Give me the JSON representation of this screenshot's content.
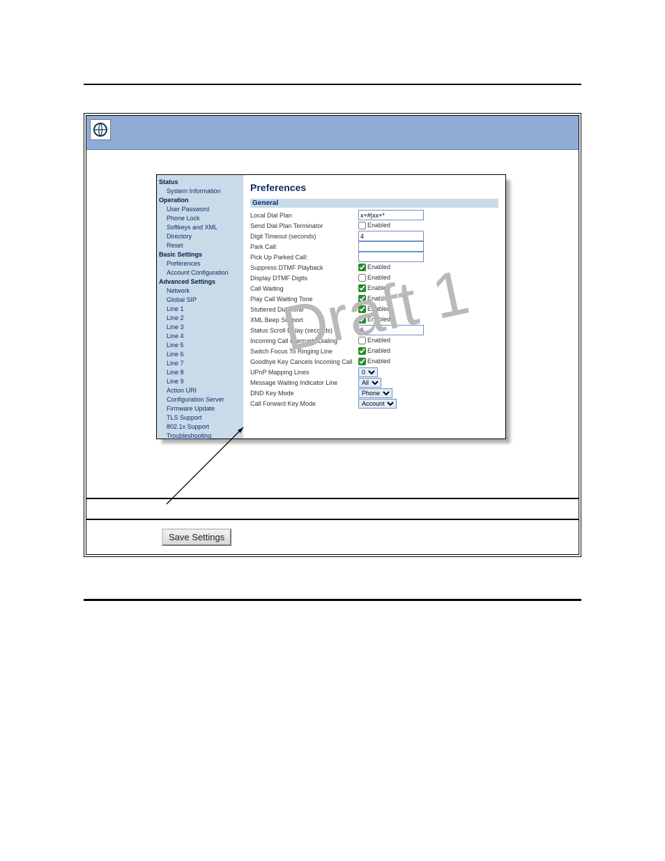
{
  "section_header": {
    "general": "General"
  },
  "title": "Preferences",
  "nav": {
    "status": "Status",
    "sysinfo": "System Information",
    "operation": "Operation",
    "userpw": "User Password",
    "phonelock": "Phone Lock",
    "softkeys": "Softkeys and XML",
    "directory": "Directory",
    "reset": "Reset",
    "basic": "Basic Settings",
    "prefs": "Preferences",
    "acct": "Account Configuration",
    "adv": "Advanced Settings",
    "network": "Network",
    "gsip": "Global SIP",
    "l1": "Line 1",
    "l2": "Line 2",
    "l3": "Line 3",
    "l4": "Line 4",
    "l5": "Line 5",
    "l6": "Line 6",
    "l7": "Line 7",
    "l8": "Line 8",
    "l9": "Line 9",
    "auri": "Action URI",
    "cfgsrv": "Configuration Server",
    "fw": "Firmware Update",
    "tls": "TLS Support",
    "8021x": "802.1x Support",
    "ts": "Troubleshooting"
  },
  "rows": {
    "r0": {
      "label": "Local Dial Plan",
      "value": "x+#|xx+*"
    },
    "r1": {
      "label": "Send Dial Plan Terminator",
      "en": "Enabled"
    },
    "r2": {
      "label": "Digit Timeout (seconds)",
      "value": "4"
    },
    "r3": {
      "label": "Park Call:"
    },
    "r4": {
      "label": "Pick Up Parked Call:"
    },
    "r5": {
      "label": "Suppress DTMF Playback",
      "en": "Enabled"
    },
    "r6": {
      "label": "Display DTMF Digits",
      "en": "Enabled"
    },
    "r7": {
      "label": "Call Waiting",
      "en": "Enabled"
    },
    "r8": {
      "label": "Play Call Waiting Tone",
      "en": "Enabled"
    },
    "r9": {
      "label": "Stuttered Dial Tone",
      "en": "Enabled"
    },
    "r10": {
      "label": "XML Beep Support",
      "en": "Enabled"
    },
    "r11": {
      "label": "Status Scroll Delay (seconds)",
      "value": "5"
    },
    "r12": {
      "label": "Incoming Call Interrupts Dialing",
      "en": "Enabled"
    },
    "r13": {
      "label": "Switch Focus To Ringing Line",
      "en": "Enabled"
    },
    "r14": {
      "label": "Goodbye Key Cancels Incoming Call",
      "en": "Enabled"
    },
    "r15": {
      "label": "UPnP Mapping Lines",
      "sel": "0"
    },
    "r16": {
      "label": "Message Waiting Indicator Line",
      "sel": "All"
    },
    "r17": {
      "label": "DND Key Mode",
      "sel": "Phone"
    },
    "r18": {
      "label": "Call Forward Key Mode",
      "sel": "Account"
    }
  },
  "checked": {
    "r5": true,
    "r7": true,
    "r8": true,
    "r9": true,
    "r10": true,
    "r13": true,
    "r14": true
  },
  "save_label": "Save Settings",
  "watermark": "Draft 1"
}
